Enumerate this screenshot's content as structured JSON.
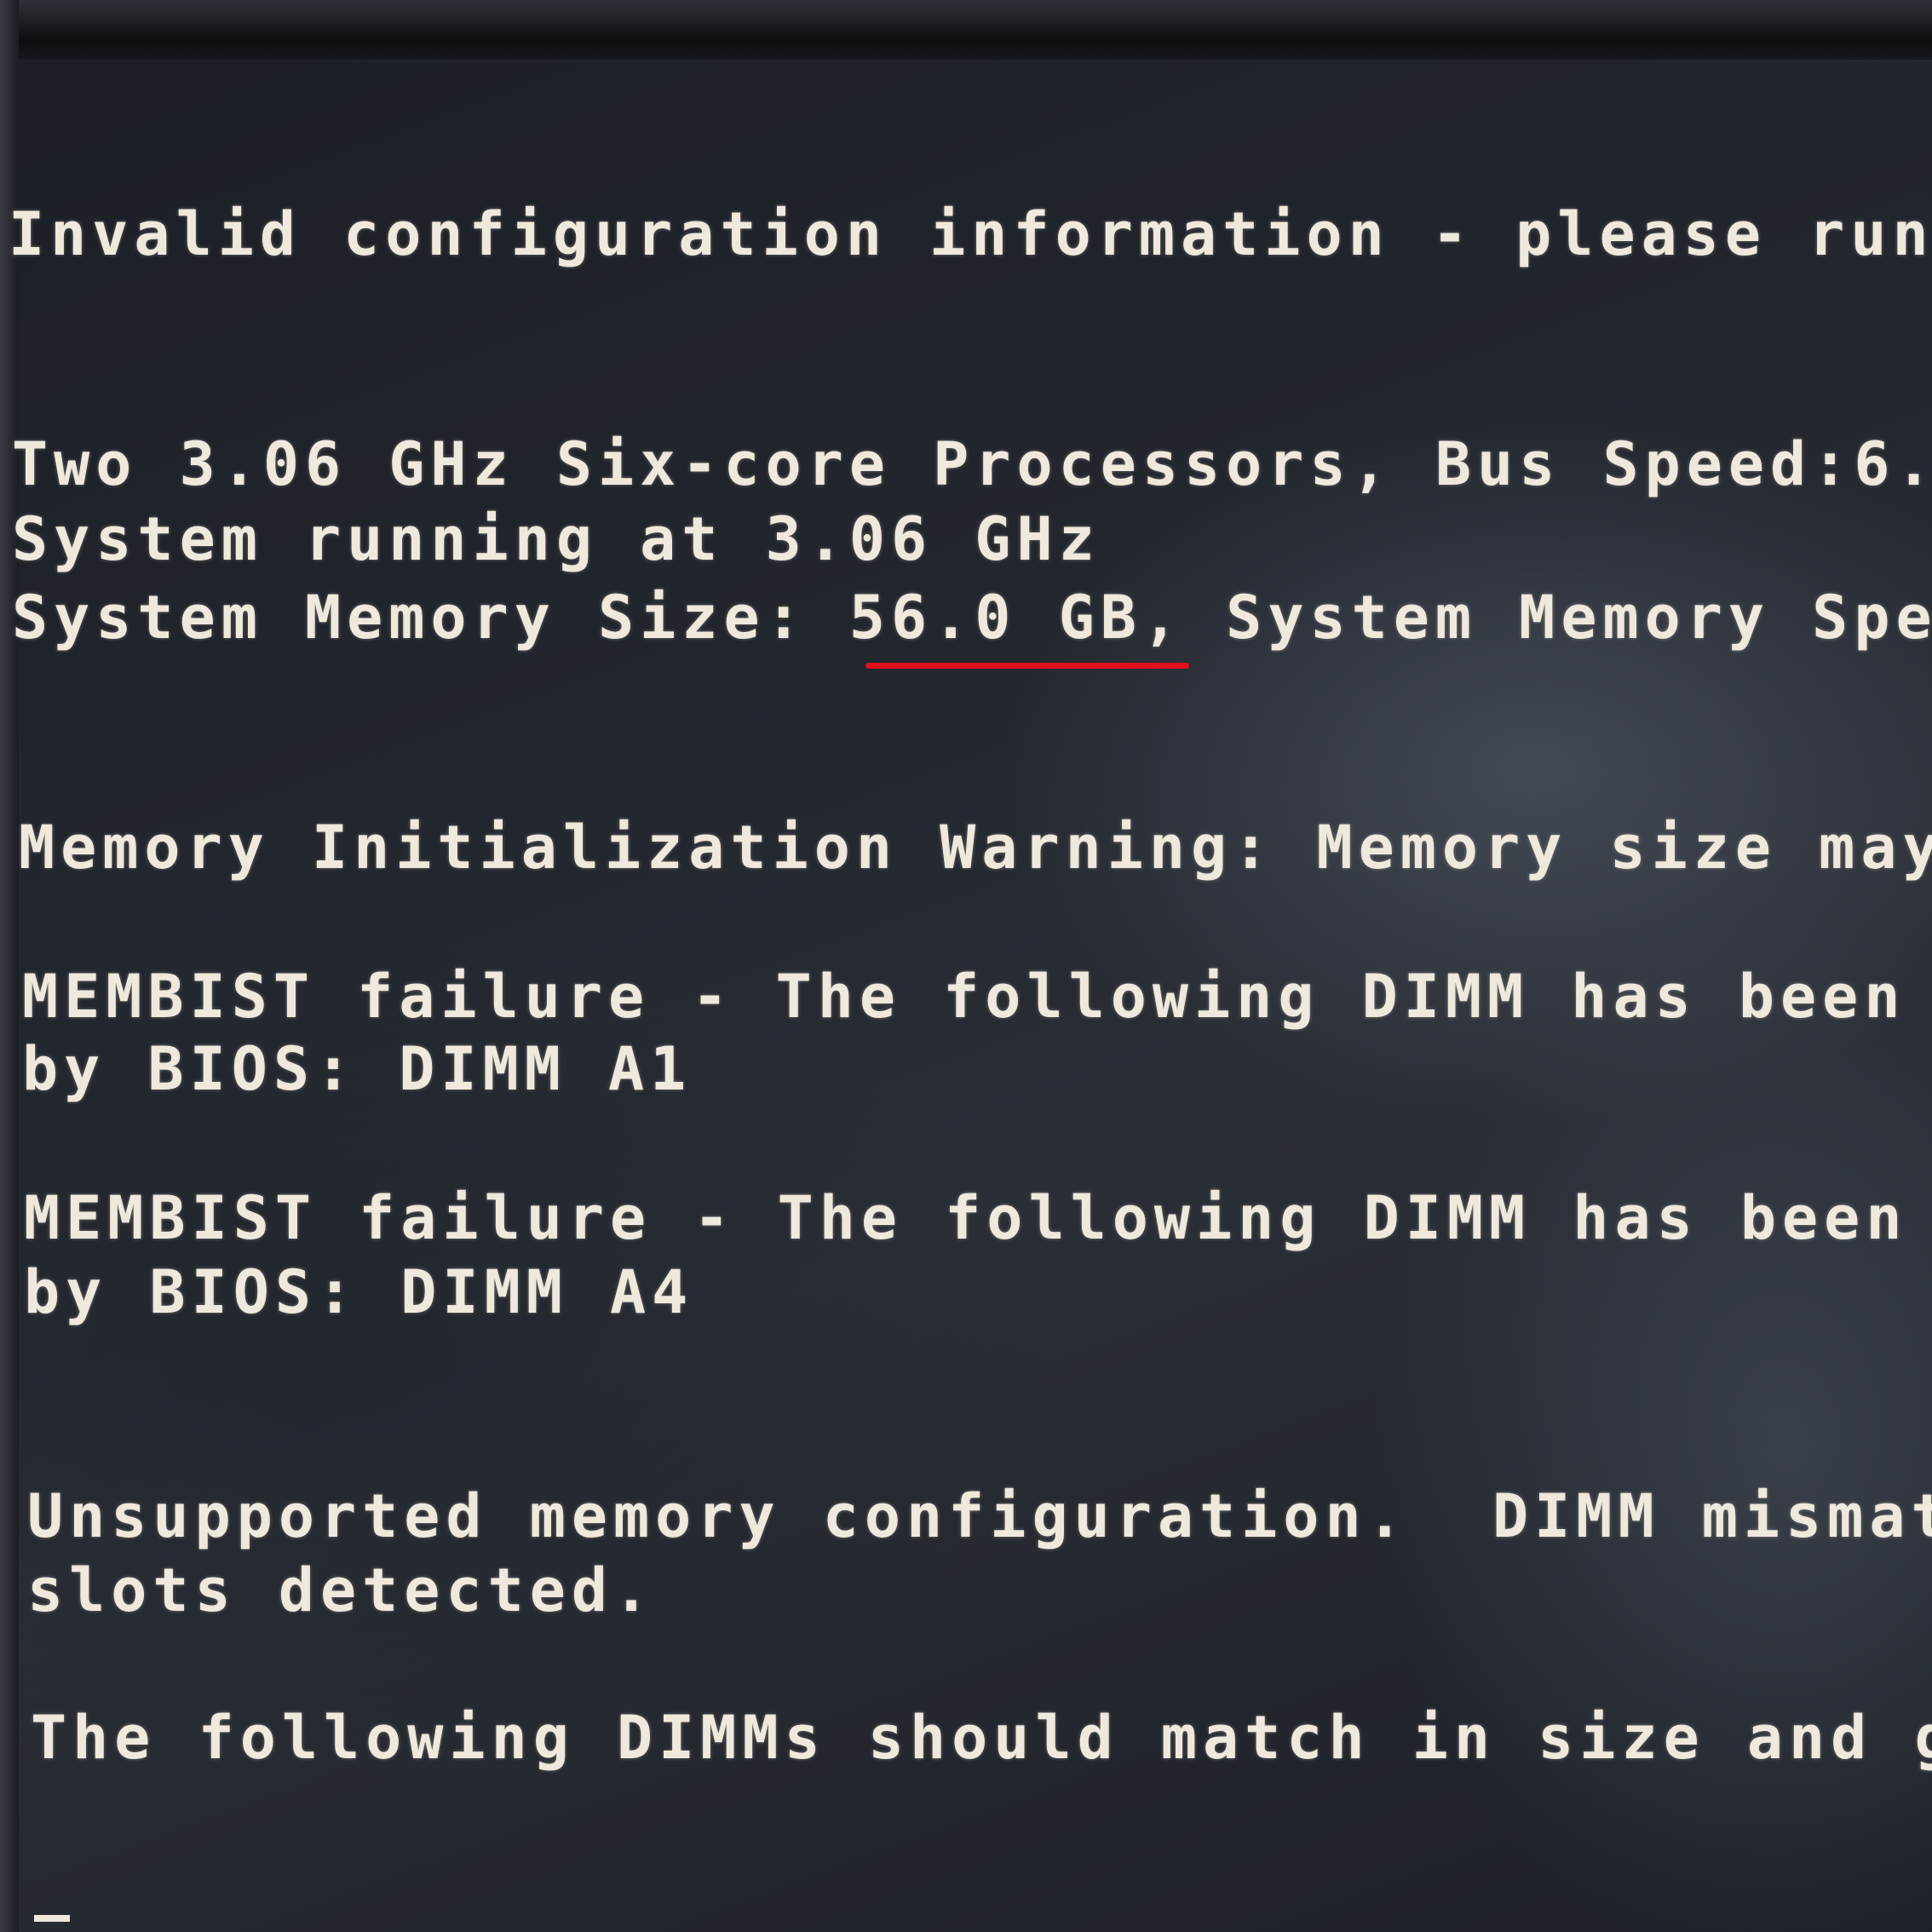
{
  "screen": {
    "lines": [
      "Invalid configuration information - please run",
      "Two 3.06 GHz Six-core Processors, Bus Speed:6.",
      "System running at 3.06 GHz",
      "System Memory Size: ",
      "56.0 GB,",
      " System Memory Spe",
      "Memory Initialization Warning: Memory size may",
      "MEMBIST failure - The following DIMM has been c",
      "by BIOS: DIMM A1",
      "MEMBIST failure - The following DIMM has been c",
      "by BIOS: DIMM A4",
      "Unsupported memory configuration.  DIMM mismatc",
      "slots detected.",
      "The following DIMMs should match in size and ge"
    ]
  },
  "colors": {
    "text": "#efe8dc",
    "background": "#1c2026",
    "highlight_underline": "#e0101c"
  }
}
